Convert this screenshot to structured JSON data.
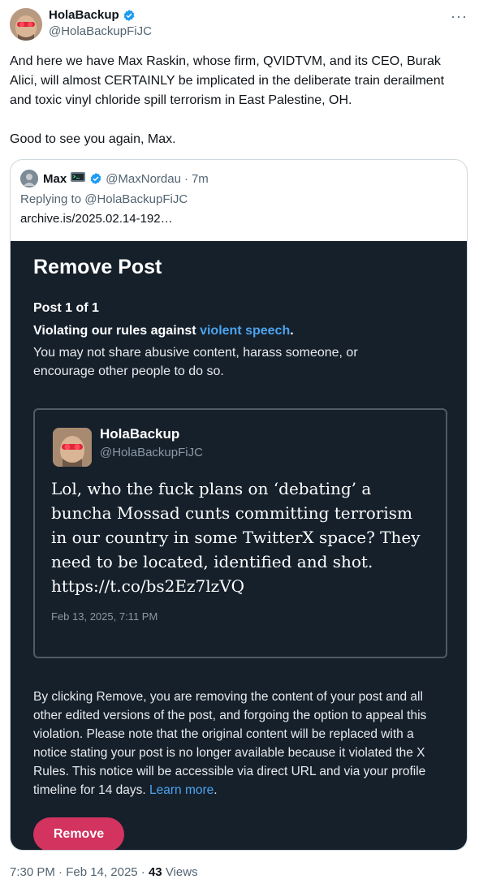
{
  "post": {
    "author_name": "HolaBackup",
    "author_handle": "@HolaBackupFiJC",
    "more_glyph": "···",
    "paragraph1": "And here we have Max Raskin, whose firm, QVIDTVM, and its CEO, Burak Alici, will almost CERTAINLY be implicated in the deliberate train derailment and toxic vinyl chloride spill terrorism in East Palestine, OH.",
    "paragraph2": "Good to see you again, Max.",
    "time": "7:30 PM",
    "date": "Feb 14, 2025",
    "views_count": "43",
    "views_label": "Views"
  },
  "quote": {
    "author_name": "Max",
    "author_handle": "@MaxNordau",
    "time_ago": "7m",
    "replying_to": "Replying to @HolaBackupFiJC",
    "link_text": "archive.is/2025.02.14-192…"
  },
  "screenshot": {
    "title": "Remove Post",
    "post_count": "Post 1 of 1",
    "violating_prefix": "Violating our rules against ",
    "violating_link": "violent speech",
    "violating_suffix": ".",
    "policy_text": "You may not share abusive content, harass someone, or encourage other people to do so.",
    "embedded": {
      "name": "HolaBackup",
      "handle": "@HolaBackupFiJC",
      "text": "Lol, who the fuck plans on ‘debating’ a buncha Mossad cunts committing terrorism in our country in some TwitterX space? They need to be located, identified and shot. https://t.co/bs2Ez7lzVQ",
      "timestamp": "Feb 13, 2025, 7:11 PM"
    },
    "notice_text": "By clicking Remove, you are removing the content of your post and all other edited versions of the post, and forgoing the option to appeal this violation. Please note that the original content will be replaced with a notice stating your post is no longer available because it violated the X Rules. This notice will be accessible via direct URL and via your profile timeline for 14 days. ",
    "notice_link": "Learn more",
    "notice_end": ".",
    "remove_label": "Remove"
  },
  "colors": {
    "verified": "#1d9bf0",
    "link_dark": "#4da3ef",
    "remove_button": "#d2335f",
    "screenshot_bg": "#15202b"
  },
  "icons": {
    "verified": "verified-badge-icon",
    "more": "more-options-icon",
    "terminal": "terminal-emoji-icon"
  }
}
